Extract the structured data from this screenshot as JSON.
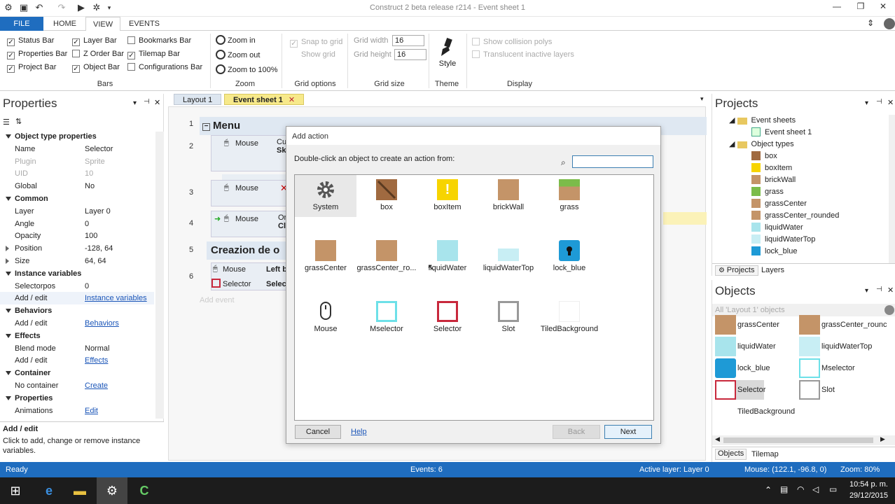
{
  "titlebar": {
    "title": "Construct 2 beta release r214 - Event sheet 1"
  },
  "ribbon_tabs": [
    {
      "label": "FILE"
    },
    {
      "label": "HOME"
    },
    {
      "label": "VIEW"
    },
    {
      "label": "EVENTS"
    }
  ],
  "ribbon": {
    "bars": {
      "items": [
        {
          "label": "Status Bar",
          "checked": "✓"
        },
        {
          "label": "Properties Bar",
          "checked": "✓"
        },
        {
          "label": "Project Bar",
          "checked": "✓"
        },
        {
          "label": "Layer Bar",
          "checked": "✓"
        },
        {
          "label": "Z Order Bar",
          "checked": ""
        },
        {
          "label": "Object Bar",
          "checked": "✓"
        },
        {
          "label": "Bookmarks Bar",
          "checked": ""
        },
        {
          "label": "Tilemap Bar",
          "checked": "✓"
        },
        {
          "label": "Configurations Bar",
          "checked": ""
        }
      ],
      "group_label": "Bars"
    },
    "zoom": {
      "zoom_in": "Zoom in",
      "zoom_out": "Zoom out",
      "zoom_100": "Zoom to 100%",
      "group_label": "Zoom"
    },
    "grid_options": {
      "snap": "Snap to grid",
      "show": "Show grid",
      "group_label": "Grid options"
    },
    "grid_size": {
      "width_label": "Grid width",
      "width_value": "16",
      "height_label": "Grid height",
      "height_value": "16",
      "group_label": "Grid size"
    },
    "theme": {
      "style_label": "Style",
      "group_label": "Theme"
    },
    "display": {
      "collision": "Show collision polys",
      "translucent": "Translucent inactive layers",
      "group_label": "Display"
    }
  },
  "properties": {
    "title": "Properties",
    "rows": [
      {
        "k": "Object type properties",
        "v": "",
        "type": "sec"
      },
      {
        "k": "Name",
        "v": "Selector",
        "type": ""
      },
      {
        "k": "Plugin",
        "v": "Sprite",
        "type": "dim"
      },
      {
        "k": "UID",
        "v": "10",
        "type": "dim"
      },
      {
        "k": "Global",
        "v": "No",
        "type": ""
      },
      {
        "k": "Common",
        "v": "",
        "type": "sec"
      },
      {
        "k": "Layer",
        "v": "Layer 0",
        "type": ""
      },
      {
        "k": "Angle",
        "v": "0",
        "type": ""
      },
      {
        "k": "Opacity",
        "v": "100",
        "type": ""
      },
      {
        "k": "Position",
        "v": "-128, 64",
        "type": "col"
      },
      {
        "k": "Size",
        "v": "64, 64",
        "type": "col"
      },
      {
        "k": "Instance variables",
        "v": "",
        "type": "sec"
      },
      {
        "k": "Selectorpos",
        "v": "0",
        "type": ""
      },
      {
        "k": "Add / edit",
        "v": "Instance variables",
        "type": "link sel"
      },
      {
        "k": "Behaviors",
        "v": "",
        "type": "sec"
      },
      {
        "k": "Add / edit",
        "v": "Behaviors",
        "type": "link"
      },
      {
        "k": "Effects",
        "v": "",
        "type": "sec"
      },
      {
        "k": "Blend mode",
        "v": "Normal",
        "type": ""
      },
      {
        "k": "Add / edit",
        "v": "Effects",
        "type": "link"
      },
      {
        "k": "Container",
        "v": "",
        "type": "sec"
      },
      {
        "k": "No container",
        "v": "Create",
        "type": "link"
      },
      {
        "k": "Properties",
        "v": "",
        "type": "sec"
      },
      {
        "k": "Animations",
        "v": "Edit",
        "type": "link"
      }
    ],
    "help_title": "Add / edit",
    "help_text": "Click to add, change or remove instance variables."
  },
  "doc_tabs": [
    {
      "label": "Layout 1"
    },
    {
      "label": "Event sheet 1"
    }
  ],
  "event_sheet": {
    "group1": "Menu",
    "group2": "Creazion de o",
    "mouse": "Mouse",
    "selector": "Selector",
    "left": "Left b",
    "selec": "Selec",
    "cu": "Cu",
    "sk": "Sk",
    "or": "Or",
    "cli": "Cli",
    "add_event": "Add event",
    "line_numbers": [
      "1",
      "2",
      "3",
      "4",
      "5",
      "6"
    ]
  },
  "dialog": {
    "title": "Add action",
    "instruction": "Double-click an object to create an action from:",
    "search_value": "",
    "objects": [
      {
        "name": "System",
        "icon": "gear-icon",
        "color": "#555555"
      },
      {
        "name": "box",
        "icon": "box-icon",
        "color": "#a06a40"
      },
      {
        "name": "boxItem",
        "icon": "exclamation-icon",
        "color": "#f7d400"
      },
      {
        "name": "brickWall",
        "icon": "brick-icon",
        "color": "#c49468"
      },
      {
        "name": "grass",
        "icon": "grass-icon",
        "color": "#7cbc4a"
      },
      {
        "name": "grassCenter",
        "icon": "dirt-icon",
        "color": "#c49468"
      },
      {
        "name": "grassCenter_ro...",
        "icon": "dirt-icon",
        "color": "#c49468"
      },
      {
        "name": "liquidWater",
        "icon": "water-icon",
        "color": "#a8e4ec"
      },
      {
        "name": "liquidWaterTop",
        "icon": "water-top-icon",
        "color": "#c8eef4"
      },
      {
        "name": "lock_blue",
        "icon": "lock-icon",
        "color": "#1e9ad6"
      },
      {
        "name": "Mouse",
        "icon": "mouse-icon",
        "color": "#333333"
      },
      {
        "name": "Mselector",
        "icon": "frame-icon",
        "color": "#6de0e8"
      },
      {
        "name": "Selector",
        "icon": "frame-icon",
        "color": "#c8283c"
      },
      {
        "name": "Slot",
        "icon": "frame-icon",
        "color": "#999999"
      },
      {
        "name": "TiledBackground",
        "icon": "blank-icon",
        "color": "#eeeeee"
      }
    ],
    "cancel": "Cancel",
    "help": "Help",
    "back": "Back",
    "next": "Next"
  },
  "projects": {
    "title": "Projects",
    "event_sheets": "Event sheets",
    "event_sheet_1": "Event sheet 1",
    "object_types": "Object types",
    "items": [
      {
        "name": "box",
        "color": "#a06a40"
      },
      {
        "name": "boxItem",
        "color": "#f7d400"
      },
      {
        "name": "brickWall",
        "color": "#c49468"
      },
      {
        "name": "grass",
        "color": "#7cbc4a"
      },
      {
        "name": "grassCenter",
        "color": "#c49468"
      },
      {
        "name": "grassCenter_rounded",
        "color": "#c49468"
      },
      {
        "name": "liquidWater",
        "color": "#a8e4ec"
      },
      {
        "name": "liquidWaterTop",
        "color": "#c8eef4"
      },
      {
        "name": "lock_blue",
        "color": "#1e9ad6"
      }
    ],
    "tabs": [
      {
        "label": "Projects"
      },
      {
        "label": "Layers"
      }
    ]
  },
  "objects": {
    "title": "Objects",
    "filter": "All 'Layout 1' objects",
    "items": [
      {
        "name": "grassCenter",
        "color": "#c49468"
      },
      {
        "name": "grassCenter_rounc",
        "color": "#c49468"
      },
      {
        "name": "liquidWater",
        "color": "#a8e4ec"
      },
      {
        "name": "liquidWaterTop",
        "color": "#c8eef4"
      },
      {
        "name": "lock_blue",
        "color": "#1e9ad6"
      },
      {
        "name": "Mselector",
        "color": "#6de0e8"
      },
      {
        "name": "Selector",
        "color": "#c8283c"
      },
      {
        "name": "Slot",
        "color": "#999999"
      },
      {
        "name": "TiledBackground",
        "color": "#ffffff"
      }
    ],
    "tabs": [
      {
        "label": "Objects"
      },
      {
        "label": "Tilemap"
      }
    ]
  },
  "statusbar": {
    "ready": "Ready",
    "events": "Events: 6",
    "active_layer": "Active layer: Layer 0",
    "mouse": "Mouse: (122.1, -96.8, 0)",
    "zoom": "Zoom: 80%"
  },
  "taskbar": {
    "time": "10:54 p. m.",
    "date": "29/12/2015"
  }
}
